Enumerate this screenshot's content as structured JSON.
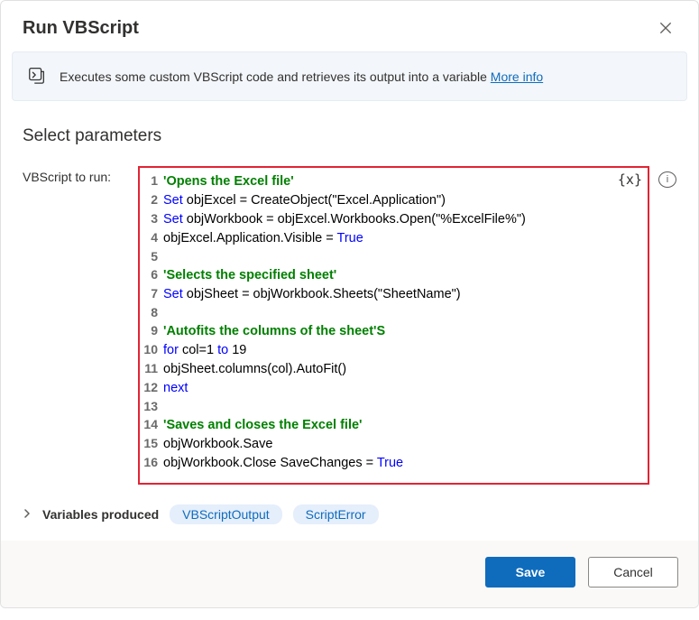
{
  "dialog": {
    "title": "Run VBScript",
    "close_aria": "Close"
  },
  "banner": {
    "text": "Executes some custom VBScript code and retrieves its output into a variable ",
    "more_info": "More info"
  },
  "params": {
    "heading": "Select parameters",
    "vbscript_label": "VBScript to run:",
    "variables_produced_label": "Variables produced",
    "var_chip_output": "VBScriptOutput",
    "var_chip_error": "ScriptError",
    "var_token_icon": "{x}"
  },
  "code_lines": [
    {
      "n": 1,
      "tokens": [
        {
          "t": "'Opens the Excel file'",
          "c": "comment"
        }
      ]
    },
    {
      "n": 2,
      "tokens": [
        {
          "t": "Set",
          "c": "kw"
        },
        {
          "t": " objExcel = CreateObject(\"Excel.Application\")",
          "c": "plain"
        }
      ]
    },
    {
      "n": 3,
      "tokens": [
        {
          "t": "Set",
          "c": "kw"
        },
        {
          "t": " objWorkbook = objExcel.Workbooks.Open(\"%ExcelFile%\")",
          "c": "plain"
        }
      ]
    },
    {
      "n": 4,
      "tokens": [
        {
          "t": "objExcel.Application.Visible = ",
          "c": "plain"
        },
        {
          "t": "True",
          "c": "kw"
        }
      ]
    },
    {
      "n": 5,
      "tokens": [
        {
          "t": "",
          "c": "plain"
        }
      ]
    },
    {
      "n": 6,
      "tokens": [
        {
          "t": "'Selects the specified sheet'",
          "c": "comment"
        }
      ]
    },
    {
      "n": 7,
      "tokens": [
        {
          "t": "Set",
          "c": "kw"
        },
        {
          "t": " objSheet = objWorkbook.Sheets(\"SheetName\")",
          "c": "plain"
        }
      ]
    },
    {
      "n": 8,
      "tokens": [
        {
          "t": "",
          "c": "plain"
        }
      ]
    },
    {
      "n": 9,
      "tokens": [
        {
          "t": "'Autofits the columns of the sheet'S",
          "c": "comment"
        }
      ]
    },
    {
      "n": 10,
      "tokens": [
        {
          "t": "for",
          "c": "kw"
        },
        {
          "t": " col=",
          "c": "plain"
        },
        {
          "t": "1",
          "c": "plain"
        },
        {
          "t": " ",
          "c": "plain"
        },
        {
          "t": "to",
          "c": "kw"
        },
        {
          "t": " 19",
          "c": "plain"
        }
      ]
    },
    {
      "n": 11,
      "tokens": [
        {
          "t": "objSheet.columns(col).AutoFit()",
          "c": "plain"
        }
      ]
    },
    {
      "n": 12,
      "tokens": [
        {
          "t": "next",
          "c": "kw"
        }
      ]
    },
    {
      "n": 13,
      "tokens": [
        {
          "t": "",
          "c": "plain"
        }
      ]
    },
    {
      "n": 14,
      "tokens": [
        {
          "t": "'Saves and closes the Excel file'",
          "c": "comment"
        }
      ]
    },
    {
      "n": 15,
      "tokens": [
        {
          "t": "objWorkbook.Save",
          "c": "plain"
        }
      ]
    },
    {
      "n": 16,
      "tokens": [
        {
          "t": "objWorkbook.Close SaveChanges = ",
          "c": "plain"
        },
        {
          "t": "True",
          "c": "kw"
        }
      ]
    }
  ],
  "footer": {
    "save": "Save",
    "cancel": "Cancel"
  }
}
